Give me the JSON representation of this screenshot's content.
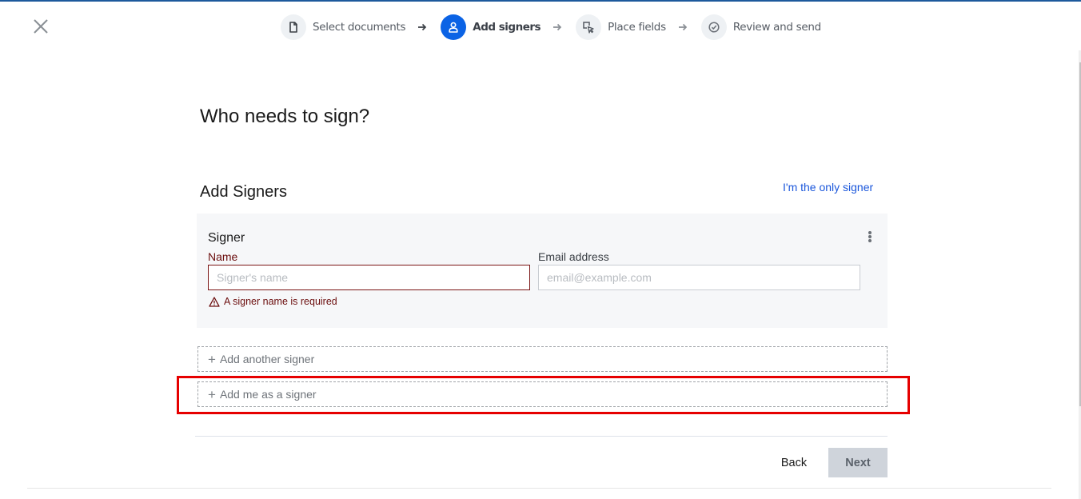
{
  "header": {
    "close_label": "Close",
    "steps": [
      {
        "label": "Select documents",
        "icon": "document-icon",
        "state": "completed"
      },
      {
        "label": "Add signers",
        "icon": "user-icon",
        "state": "active"
      },
      {
        "label": "Place fields",
        "icon": "cursor-select-icon",
        "state": "upcoming"
      },
      {
        "label": "Review and send",
        "icon": "check-circle-icon",
        "state": "upcoming"
      }
    ]
  },
  "main": {
    "title": "Who needs to sign?",
    "section_title": "Add Signers",
    "only_signer_link": "I'm the only signer",
    "signer_card": {
      "title": "Signer",
      "name_label": "Name",
      "name_value": "",
      "name_placeholder": "Signer's name",
      "name_error": "A signer name is required",
      "email_label": "Email address",
      "email_value": "",
      "email_placeholder": "email@example.com"
    },
    "add_another_signer": "Add another signer",
    "add_me_as_signer": "Add me as a signer",
    "plus_glyph": "+"
  },
  "footer": {
    "back_label": "Back",
    "next_label": "Next",
    "next_disabled": true
  },
  "colors": {
    "accent": "#0b63e5",
    "link": "#1a56db",
    "error": "#6b0d0d",
    "highlight": "#e60000",
    "next_button_bg": "#cfd4db"
  }
}
